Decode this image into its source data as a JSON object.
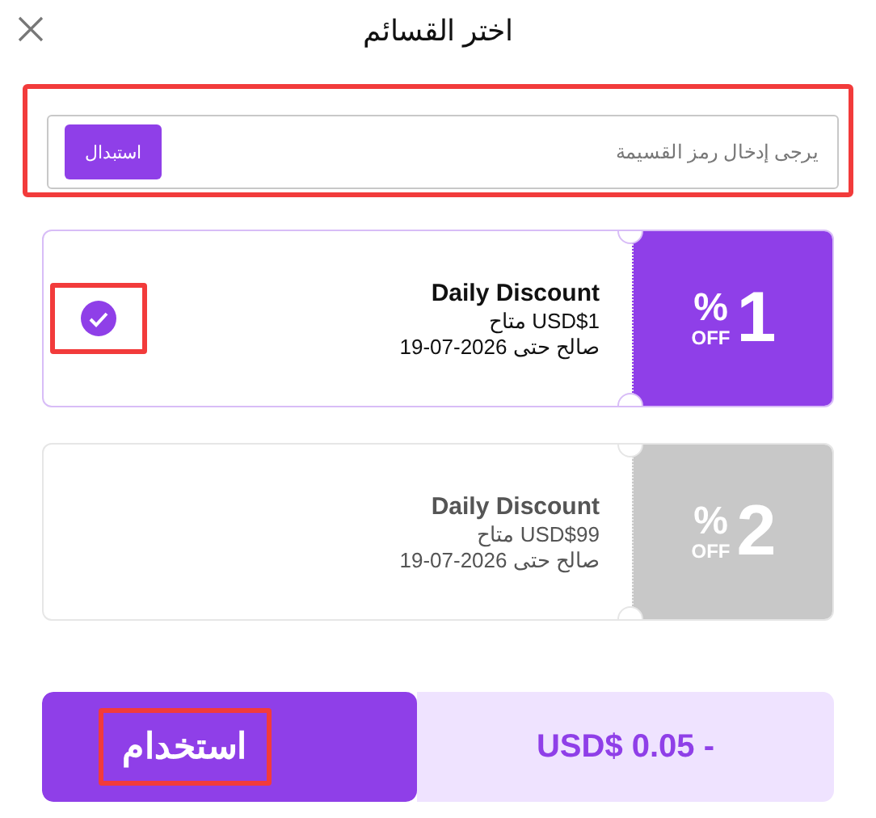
{
  "header": {
    "title": "اختر القسائم"
  },
  "code_entry": {
    "placeholder": "يرجى إدخال رمز القسيمة",
    "button": "استبدال",
    "highlighted": true
  },
  "coupons": [
    {
      "name": "Daily Discount",
      "available": "USD$1 متاح",
      "valid": "19-07-2026 صالح حتى",
      "value": "1",
      "percent": "%",
      "off": "OFF",
      "selected": true,
      "highlighted": true
    },
    {
      "name": "Daily Discount",
      "available": "USD$99 متاح",
      "valid": "19-07-2026 صالح حتى",
      "value": "2",
      "percent": "%",
      "off": "OFF",
      "selected": false,
      "highlighted": false
    }
  ],
  "footer": {
    "button": "استخدام",
    "button_highlighted": true,
    "amount": "USD$ 0.05 -"
  }
}
